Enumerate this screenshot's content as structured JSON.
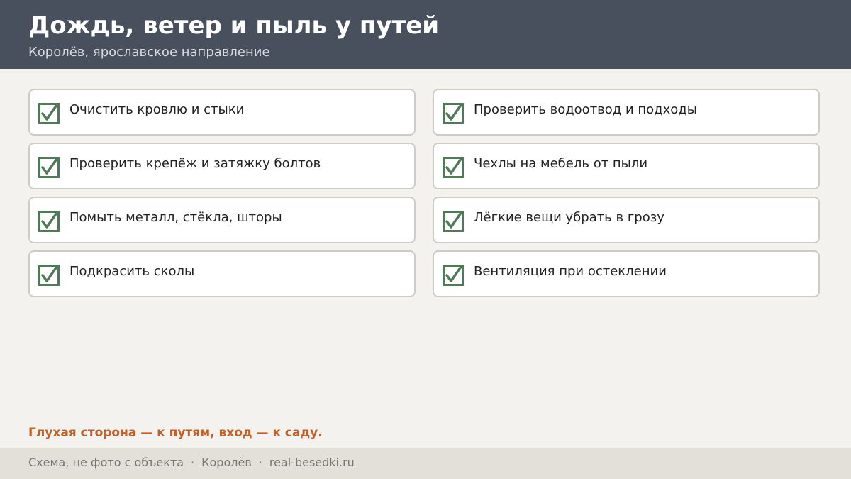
{
  "header": {
    "title": "Дождь, ветер и пыль у путей",
    "subtitle": "Королёв, ярославское направление",
    "background_color": "#47505c"
  },
  "checklist": {
    "check_icon": "checkbox-checked-icon",
    "check_color": "#4e7a58",
    "items": [
      {
        "label": "Очистить кровлю и стыки",
        "checked": true
      },
      {
        "label": "Проверить водоотвод и подходы",
        "checked": true
      },
      {
        "label": "Проверить крепёж и затяжку болтов",
        "checked": true
      },
      {
        "label": "Чехлы на мебель от пыли",
        "checked": true
      },
      {
        "label": "Помыть металл, стёкла, шторы",
        "checked": true
      },
      {
        "label": "Лёгкие вещи убрать в грозу",
        "checked": true
      },
      {
        "label": "Подкрасить сколы",
        "checked": true
      },
      {
        "label": "Вентиляция при остеклении",
        "checked": true
      }
    ]
  },
  "note": {
    "text": "Глухая сторона — к путям, вход — к саду.",
    "color": "#c0602a"
  },
  "footer": {
    "caption": "Схема, не фото с объекта",
    "separator": "·",
    "city": "Королёв",
    "site": "real-besedki.ru"
  }
}
